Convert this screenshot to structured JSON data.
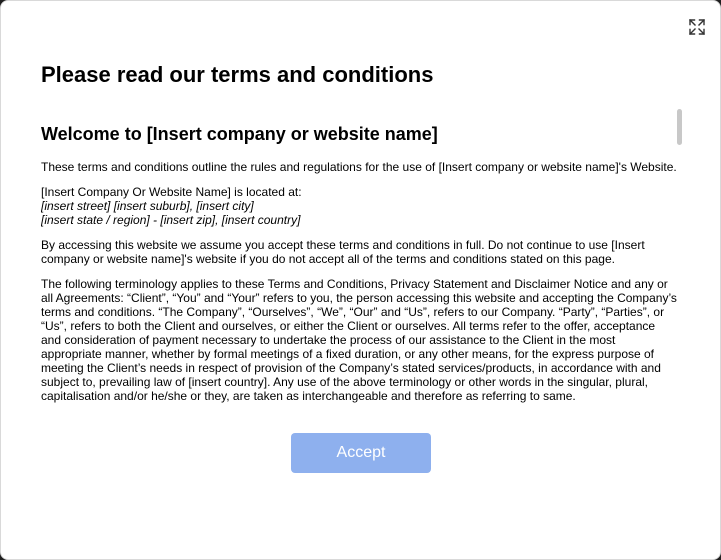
{
  "modal": {
    "title": "Please read our terms and conditions",
    "expand_icon": "expand-icon",
    "accept_label": "Accept",
    "accent_color": "#8eb0ee",
    "scroll_position_fraction": 0.0
  },
  "terms": {
    "heading": "Welcome to [Insert company or website name]",
    "intro": "These terms and conditions outline the rules and regulations for the use of [Insert company or website name]'s Website.",
    "location_label": "[Insert Company Or Website Name] is located at:",
    "address_line1": "[insert street] [insert suburb], [insert city]",
    "address_line2": "[insert state / region] - [insert zip], [insert country]",
    "acceptance": "By accessing this website we assume you accept these terms and conditions in full. Do not continue to use [Insert company or website name]'s website if you do not accept all of the terms and conditions stated on this page.",
    "terminology": "The following terminology applies to these Terms and Conditions, Privacy Statement and Disclaimer Notice and any or all Agreements: “Client”, “You” and “Your” refers to you, the person accessing this website and accepting the Company’s terms and conditions. “The Company”, “Ourselves”, “We”, “Our” and “Us”, refers to our Company. “Party”, “Parties”, or “Us”, refers to both the Client and ourselves, or either the Client or ourselves. All terms refer to the offer, acceptance and consideration of payment necessary to undertake the process of our assistance to the Client in the most appropriate manner, whether by formal meetings of a fixed duration, or any other means, for the express purpose of meeting the Client’s needs in respect of provision of the Company’s stated services/products, in accordance with and subject to, prevailing law of [insert country]. Any use of the above terminology or other words in the singular, plural, capitalisation and/or he/she or they, are taken as interchangeable and therefore as referring to same."
  }
}
